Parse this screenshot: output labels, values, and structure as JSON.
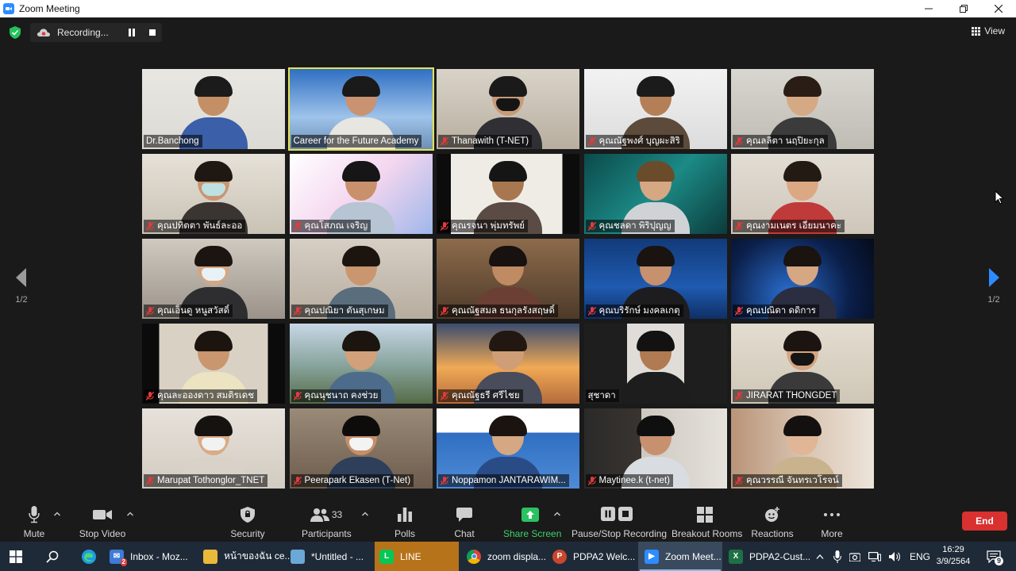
{
  "window": {
    "title": "Zoom Meeting"
  },
  "recording": {
    "status": "Recording..."
  },
  "view": {
    "label": "View"
  },
  "gallery": {
    "page_indicator": "1/2",
    "active_speaker": "Career for the Future Academy",
    "participants": [
      {
        "name": "Dr.Banchong",
        "muted": false
      },
      {
        "name": "Career for the Future Academy",
        "muted": false
      },
      {
        "name": "Thanawith (T-NET)",
        "muted": true
      },
      {
        "name": "คุณณัฐพงศ์ บุญผะสิริ",
        "muted": true
      },
      {
        "name": "คุณลลิตา นฤปิยะกุล",
        "muted": true
      },
      {
        "name": "คุณปทิตตา พันธ์ละออ",
        "muted": true
      },
      {
        "name": "คุณโสภณ เจริญ",
        "muted": true
      },
      {
        "name": "คุณรจนา พุ่มทรัพย์",
        "muted": true
      },
      {
        "name": "คุณชลดา พิริปุญญ",
        "muted": true
      },
      {
        "name": "คุณงามเนตร เอี่ยมนาคะ",
        "muted": true
      },
      {
        "name": "คุณเอ็นดู หนูสวัสดิ์",
        "muted": true
      },
      {
        "name": "คุณปณิยา ตันสุเกษม",
        "muted": true
      },
      {
        "name": "คุณณัฐสมล ธนกุลรังสฤษดิ์",
        "muted": true
      },
      {
        "name": "คุณบริรักษ์ มงคลเกตุ",
        "muted": true
      },
      {
        "name": "คุณปณิดา ดดิการ",
        "muted": true
      },
      {
        "name": "คุณละอองดาว สมติรเดช",
        "muted": true
      },
      {
        "name": "คุณนุชนาถ คงช่วย",
        "muted": true
      },
      {
        "name": "คุณณัฐธรี ศรีไชย",
        "muted": true
      },
      {
        "name": "สุชาดา",
        "muted": false
      },
      {
        "name": "JIRARAT THONGDET",
        "muted": true
      },
      {
        "name": "Marupat Tothonglor_TNET",
        "muted": true
      },
      {
        "name": "Peerapark Ekasen (T-Net)",
        "muted": true
      },
      {
        "name": "Noppamon JANTARAWIM...",
        "muted": true
      },
      {
        "name": "Maytinee.k (t-net)",
        "muted": true
      },
      {
        "name": "คุณวรรณี จันทรเวโรจน์",
        "muted": true
      }
    ]
  },
  "toolbar": {
    "mute": "Mute",
    "stop_video": "Stop Video",
    "security": "Security",
    "participants": "Participants",
    "participants_count": "33",
    "polls": "Polls",
    "chat": "Chat",
    "share_screen": "Share Screen",
    "pause_stop_recording": "Pause/Stop Recording",
    "breakout_rooms": "Breakout Rooms",
    "reactions": "Reactions",
    "more": "More",
    "end": "End"
  },
  "taskbar": {
    "items": [
      {
        "label": "Inbox - Moz...",
        "badge": "2"
      },
      {
        "label": "หน้าของฉัน ce..."
      },
      {
        "label": "*Untitled - ..."
      },
      {
        "label": "LINE"
      },
      {
        "label": "zoom displa..."
      },
      {
        "label": "PDPA2 Welc..."
      },
      {
        "label": "Zoom Meet..."
      },
      {
        "label": "PDPA2-Cust..."
      }
    ],
    "language": "ENG",
    "time": "16:29",
    "date": "3/9/2564",
    "notifications": "9"
  },
  "colors": {
    "background": "#1a1a1a",
    "active_speaker_border": "#e8e34e",
    "share_green": "#3cd26b",
    "end_red": "#d93030",
    "zoom_blue": "#2d8cff",
    "mic_off_red": "#e03b3b"
  }
}
